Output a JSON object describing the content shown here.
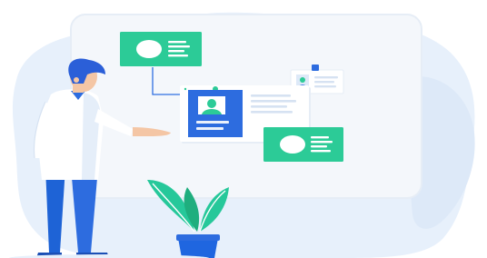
{
  "illustration": {
    "type": "flat-vector-hero",
    "subject": "person-presenting-connected-cards-on-board",
    "colors": {
      "blob": "#E7F0FB",
      "board": "#F4F7FB",
      "board_edge": "#E6EDF6",
      "green": "#2CCB97",
      "green_dark": "#1FAE7E",
      "blue": "#2D6CDF",
      "blue_dark": "#1F55BE",
      "skin": "#F4C6A5",
      "shirt": "#FFFFFF",
      "shirt_shadow": "#E5EEF9",
      "hair": "#2B5FD8",
      "pants": "#1E63D6",
      "shoe": "#1B4FB5",
      "pot": "#1F66E0",
      "leaf": "#26C89A",
      "line": "#D6E2F2",
      "connector": "#2E6FE1",
      "card_white": "#FFFFFF",
      "icon_white": "#FFFFFF"
    },
    "icons": [
      "profile-card-icon",
      "avatar-icon",
      "document-card-icon",
      "potted-plant-icon",
      "presenter-figure-icon"
    ]
  }
}
